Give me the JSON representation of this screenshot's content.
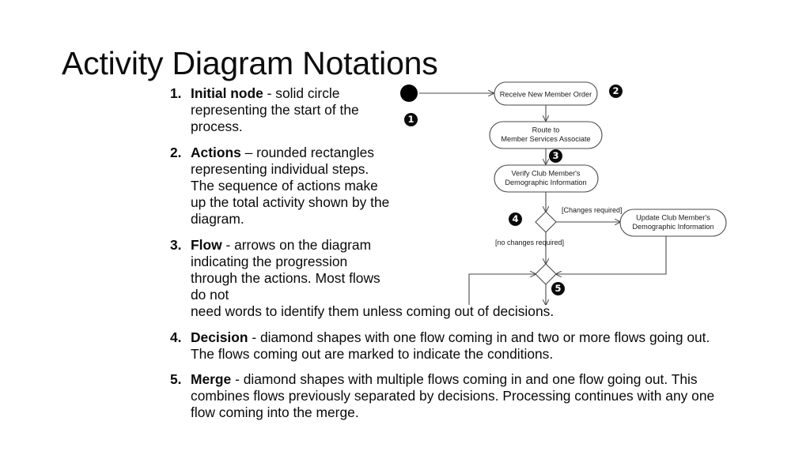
{
  "slide": {
    "title": "Activity Diagram Notations"
  },
  "notations": [
    {
      "number": "1.",
      "term": "Initial node",
      "body": " - solid circle representing the start of the process."
    },
    {
      "number": "2.",
      "term": "Actions",
      "body": " – rounded rectangles representing individual steps. The sequence of actions make up the total activity shown by the diagram."
    },
    {
      "number": "3.",
      "term": "Flow",
      "body": " - arrows on the diagram indicating the progression through the actions. Most flows do not",
      "body_overflow": "need words to identify them unless coming out of decisions."
    },
    {
      "number": "4.",
      "term": "Decision",
      "body": " - diamond shapes with one flow coming in and two or more flows going out. The flows coming out are marked to indicate the conditions."
    },
    {
      "number": "5.",
      "term": "Merge",
      "body": " - diamond shapes with multiple flows coming in and one flow going out. This combines flows previously separated by decisions. Processing continues with any one flow coming into the merge."
    }
  ],
  "diagram": {
    "type": "uml-activity-diagram",
    "nodes": {
      "initial": "",
      "action_receive": "Receive New Member Order",
      "action_route_line1": "Route to",
      "action_route_line2": "Member Services Associate",
      "action_verify_line1": "Verify Club Member's",
      "action_verify_line2": "Demographic Information",
      "action_update_line1": "Update Club Member's",
      "action_update_line2": "Demographic Information"
    },
    "guards": {
      "changes_required": "[Changes required]",
      "no_changes_required": "[no changes required]"
    },
    "callouts": {
      "one": "1",
      "two": "2",
      "three": "3",
      "four": "4",
      "five": "5"
    },
    "colors": {
      "stroke": "#4a4a4a",
      "fill": "#ffffff",
      "text": "#1a1a1a",
      "initial_node": "#000000",
      "badge_bg": "#0b0b0b",
      "badge_fg": "#ffffff"
    }
  }
}
